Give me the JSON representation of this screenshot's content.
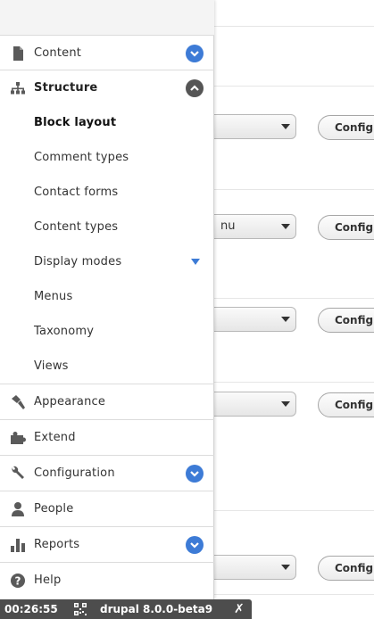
{
  "background": {
    "select_partial_text": "nu",
    "configure_label": "Configure"
  },
  "menu": {
    "content": {
      "label": "Content",
      "icon": "document-icon",
      "expanded": false
    },
    "structure": {
      "label": "Structure",
      "icon": "sitemap-icon",
      "expanded": true
    },
    "structure_items": [
      {
        "label": "Block layout",
        "active": true
      },
      {
        "label": "Comment types"
      },
      {
        "label": "Contact forms"
      },
      {
        "label": "Content types"
      },
      {
        "label": "Display modes",
        "has_submenu": true
      },
      {
        "label": "Menus"
      },
      {
        "label": "Taxonomy"
      },
      {
        "label": "Views"
      }
    ],
    "appearance": {
      "label": "Appearance",
      "icon": "paintbrush-icon"
    },
    "extend": {
      "label": "Extend",
      "icon": "puzzle-icon"
    },
    "configuration": {
      "label": "Configuration",
      "icon": "wrench-icon",
      "expanded": false
    },
    "people": {
      "label": "People",
      "icon": "person-icon"
    },
    "reports": {
      "label": "Reports",
      "icon": "bar-chart-icon",
      "expanded": false
    },
    "help": {
      "label": "Help",
      "icon": "question-icon"
    }
  },
  "statusbar": {
    "time": "00:26:55",
    "version": "drupal 8.0.0-beta9",
    "close": "✗"
  },
  "colors": {
    "accent": "#3d7bd6",
    "dark_toggle": "#555555",
    "statusbar_bg": "#4d4d4d"
  }
}
